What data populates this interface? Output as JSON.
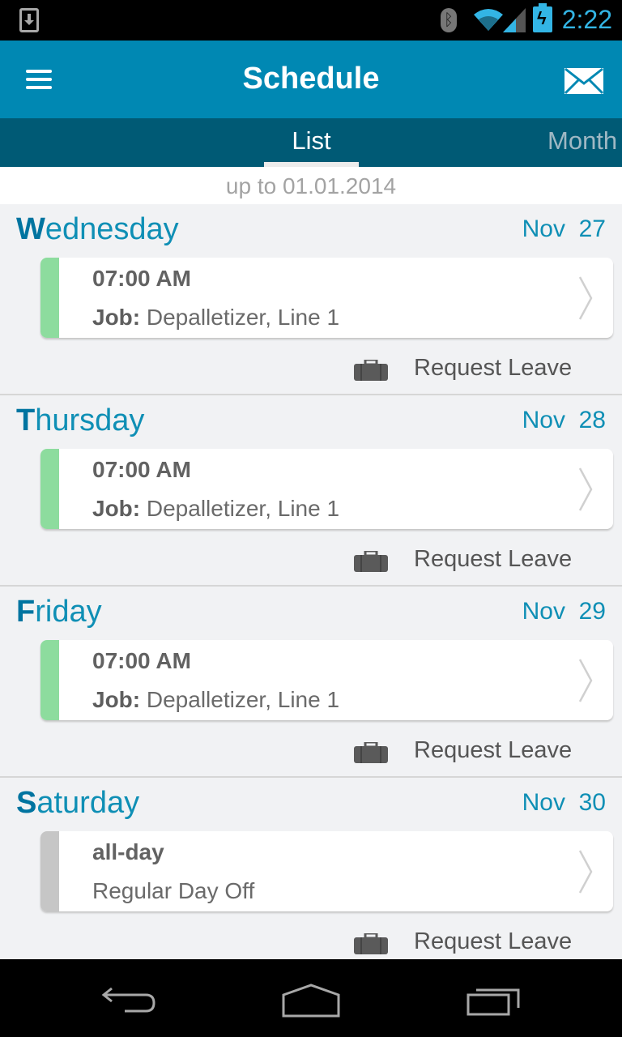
{
  "status_bar": {
    "time": "2:22",
    "icons": [
      "download-notification-icon",
      "bluetooth-icon",
      "wifi-icon",
      "cell-signal-icon",
      "battery-charging-icon"
    ]
  },
  "app_bar": {
    "title": "Schedule",
    "left_icon": "menu-icon",
    "right_icon": "mail-icon"
  },
  "tabs": [
    {
      "label": "List",
      "selected": true
    },
    {
      "label": "Month",
      "selected": false
    }
  ],
  "range_label": "up to 01.01.2014",
  "days": [
    {
      "day_initial": "W",
      "day_rest": "ednesday",
      "month": "Nov",
      "date": "27",
      "shift": {
        "time": "07:00 AM",
        "job_label": "Job:",
        "job_value": " Depalletizer, Line 1",
        "type": "work"
      },
      "action": "Request Leave"
    },
    {
      "day_initial": "T",
      "day_rest": "hursday",
      "month": "Nov",
      "date": "28",
      "shift": {
        "time": "07:00 AM",
        "job_label": "Job:",
        "job_value": " Depalletizer, Line 1",
        "type": "work"
      },
      "action": "Request Leave"
    },
    {
      "day_initial": "F",
      "day_rest": "riday",
      "month": "Nov",
      "date": "29",
      "shift": {
        "time": "07:00 AM",
        "job_label": "Job:",
        "job_value": " Depalletizer, Line 1",
        "type": "work"
      },
      "action": "Request Leave"
    },
    {
      "day_initial": "S",
      "day_rest": "aturday",
      "month": "Nov",
      "date": "30",
      "shift": {
        "time": "all-day",
        "job_label": "",
        "job_value": "Regular Day Off",
        "type": "off"
      },
      "action": "Request Leave"
    }
  ],
  "colors": {
    "app_bar": "#0088b3",
    "tab_bar": "#005a75",
    "accent_text": "#0f8fb5",
    "work_strip": "#8ddc9e",
    "off_strip": "#c6c6c6"
  },
  "nav_bar": {
    "buttons": [
      "back-icon",
      "home-icon",
      "recent-apps-icon"
    ]
  }
}
